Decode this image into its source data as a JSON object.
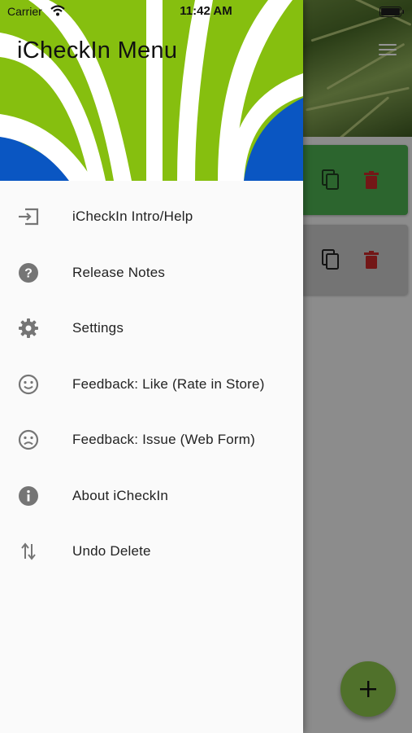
{
  "status_bar": {
    "carrier": "Carrier",
    "time": "11:42 AM"
  },
  "drawer": {
    "title": "iCheckIn Menu",
    "items": [
      {
        "label": "iCheckIn Intro/Help",
        "icon": "login-icon"
      },
      {
        "label": "Release Notes",
        "icon": "help-circle-icon"
      },
      {
        "label": "Settings",
        "icon": "gear-icon"
      },
      {
        "label": "Feedback: Like (Rate in Store)",
        "icon": "smiley-happy-icon"
      },
      {
        "label": "Feedback: Issue (Web Form)",
        "icon": "smiley-sad-icon"
      },
      {
        "label": "About iCheckIn",
        "icon": "info-icon"
      },
      {
        "label": "Undo Delete",
        "icon": "swap-vertical-icon"
      }
    ]
  },
  "colors": {
    "header_green": "#86bf0f",
    "header_blue": "#0a56c2",
    "card_active": "#4caf50",
    "card_inactive": "#c8c8c8",
    "delete_red": "#d32f2f",
    "fab": "#8bc34a",
    "icon_gray": "#757575"
  }
}
